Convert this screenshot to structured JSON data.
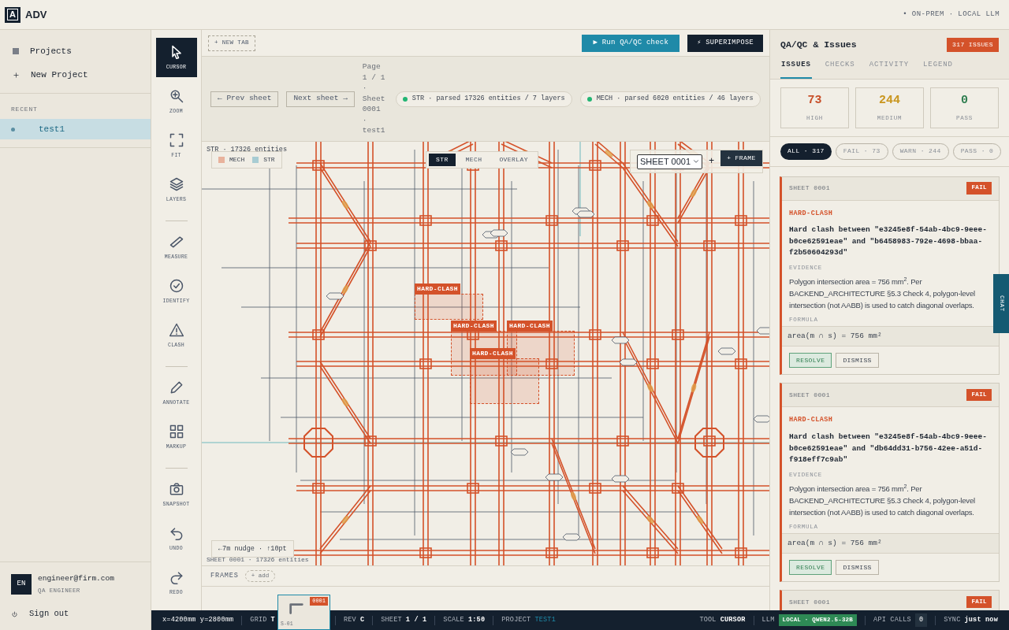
{
  "app": {
    "logo": "A",
    "name": "ADV",
    "mode": "• ON-PREM · LOCAL LLM"
  },
  "sidebar": {
    "nav": [
      {
        "label": "Projects"
      },
      {
        "label": "New Project"
      }
    ],
    "recent_heading": "RECENT",
    "recent": [
      {
        "label": "test1",
        "selected": true
      }
    ],
    "user": {
      "initials": "EN",
      "email": "engineer@firm.com",
      "role": "QA ENGINEER"
    },
    "sign_out": "Sign out"
  },
  "tool_groups": [
    [
      {
        "label": "CURSOR",
        "selected": true
      },
      {
        "label": "ZOOM",
        "selected": false
      },
      {
        "label": "FIT",
        "selected": false
      },
      {
        "label": "LAYERS",
        "selected": false
      }
    ],
    [
      {
        "label": "MEASURE",
        "selected": false
      },
      {
        "label": "IDENTIFY",
        "selected": false
      },
      {
        "label": "CLASH",
        "selected": false
      }
    ],
    [
      {
        "label": "ANNOTATE",
        "selected": false
      },
      {
        "label": "MARKUP",
        "selected": false
      }
    ],
    [
      {
        "label": "SNAPSHOT",
        "selected": false
      },
      {
        "label": "UNDO",
        "selected": false
      },
      {
        "label": "REDO",
        "selected": false
      }
    ]
  ],
  "tab_bar": {
    "new_tab": "+ NEW TAB",
    "run_button": "▶  Run QA/QC check",
    "superimpose_button": "⚡ SUPERIMPOSE"
  },
  "sheet_bar": {
    "prev": "← Prev sheet",
    "next": "Next sheet →",
    "page_info": "Page 1 / 1 · Sheet 0001 · test1",
    "layers": [
      {
        "label": "STR · parsed 17326 entities / 7 layers",
        "color": "#22b573"
      },
      {
        "label": "MECH · parsed 6020 entities / 46 layers",
        "color": "#22b573"
      }
    ]
  },
  "canvas": {
    "status_top": "STR · 17326 entities",
    "legend": [
      {
        "label": "MECH",
        "color": "#e8b29c"
      },
      {
        "label": "STR",
        "color": "#a8ccd3"
      }
    ],
    "view_modes": [
      {
        "label": "STR",
        "selected": true
      },
      {
        "label": "MECH",
        "selected": false
      },
      {
        "label": "OVERLAY",
        "selected": false
      }
    ],
    "sheet_select": "SHEET 0001",
    "add_symbol": "+",
    "frame_button": "+ FRAME",
    "clashes": [
      {
        "label": "HARD-CLASH"
      },
      {
        "label": "HARD-CLASH"
      },
      {
        "label": "HARD-CLASH"
      },
      {
        "label": "HARD-CLASH"
      }
    ],
    "nudge": "←7m nudge · ↑10pt",
    "status_bottom": "SHEET 0001 · 17326 entities"
  },
  "frames": {
    "label": "FRAMES",
    "add": "+ add"
  },
  "sheets": {
    "thumbnails": [
      {
        "badge": "0001",
        "caption": "S-01"
      }
    ]
  },
  "status_bar": [
    {
      "kind": "plain",
      "value": "x=4200mm y=2800mm"
    },
    {
      "kind": "pair",
      "key": "GRID",
      "value": "T"
    },
    {
      "kind": "pair",
      "key": "REV",
      "value": "C"
    },
    {
      "kind": "pair",
      "key": "SHEET",
      "value": "1 / 1"
    },
    {
      "kind": "pair",
      "key": "SCALE",
      "value": "1:50"
    },
    {
      "kind": "link",
      "key": "PROJECT",
      "value": "TEST1"
    },
    {
      "kind": "spacer"
    },
    {
      "kind": "pair",
      "key": "TOOL",
      "value": "CURSOR"
    },
    {
      "kind": "badge",
      "key": "LLM",
      "value": "LOCAL · QWEN2.5-32B"
    },
    {
      "kind": "count",
      "key": "API CALLS",
      "value": "0"
    },
    {
      "kind": "pair",
      "key": "SYNC",
      "value": "just now"
    }
  ],
  "panel": {
    "title": "QA/QC & Issues",
    "count_badge": "317 ISSUES",
    "tabs": [
      {
        "label": "ISSUES",
        "selected": true
      },
      {
        "label": "CHECKS",
        "selected": false
      },
      {
        "label": "ACTIVITY",
        "selected": false
      },
      {
        "label": "LEGEND",
        "selected": false
      }
    ],
    "stats": [
      {
        "value": "73",
        "label": "HIGH",
        "color": "#c8502a"
      },
      {
        "value": "244",
        "label": "MEDIUM",
        "color": "#c9961f"
      },
      {
        "value": "0",
        "label": "PASS",
        "color": "#2e7d4f"
      }
    ],
    "filters": [
      {
        "label": "ALL · 317",
        "selected": true
      },
      {
        "label": "FAIL · 73",
        "selected": false
      },
      {
        "label": "WARN · 244",
        "selected": false
      },
      {
        "label": "PASS · 0",
        "selected": false
      }
    ],
    "issues": [
      {
        "sheet": "SHEET 0001",
        "status": "FAIL",
        "type": "HARD-CLASH",
        "title": "Hard clash between \"e3245e8f-54ab-4bc9-9eee-b0ce62591eae\" and \"b6458983-792e-4698-bbaa-f2b50604293d\"",
        "evidence_label": "EVIDENCE",
        "evidence": "Polygon intersection area = 756 mm$^{2}$. Per BACKEND_ARCHITECTURE §5.3 Check 4, polygon-level intersection (not AABB) is used to catch diagonal overlaps.",
        "formula_label": "FORMULA",
        "formula": "area(m ∩ s) = 756 mm²",
        "actions": [
          "RESOLVE",
          "DISMISS"
        ]
      },
      {
        "sheet": "SHEET 0001",
        "status": "FAIL",
        "type": "HARD-CLASH",
        "title": "Hard clash between \"e3245e8f-54ab-4bc9-9eee-b0ce62591eae\" and \"db64dd31-b756-42ee-a51d-f918eff7c9ab\"",
        "evidence_label": "EVIDENCE",
        "evidence": "Polygon intersection area = 756 mm$^{2}$. Per BACKEND_ARCHITECTURE §5.3 Check 4, polygon-level intersection (not AABB) is used to catch diagonal overlaps.",
        "formula_label": "FORMULA",
        "formula": "area(m ∩ s) = 756 mm²",
        "actions": [
          "RESOLVE",
          "DISMISS"
        ]
      },
      {
        "sheet": "SHEET 0001",
        "status": "FAIL"
      }
    ],
    "chat_tab": "CHAT"
  }
}
